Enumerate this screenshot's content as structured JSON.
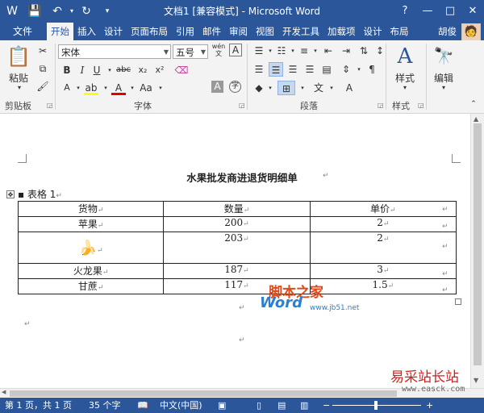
{
  "window": {
    "title": "文档1 [兼容模式] - Microsoft Word",
    "controls": [
      "?",
      "—",
      "□",
      "✕"
    ]
  },
  "quick_access": [
    "save-icon",
    "undo-icon",
    "redo-icon",
    "customize-icon"
  ],
  "tabs": {
    "file": "文件",
    "items": [
      "开始",
      "插入",
      "设计",
      "页面布局",
      "引用",
      "邮件",
      "审阅",
      "视图",
      "开发工具",
      "加载项",
      "设计",
      "布局"
    ],
    "active": 0,
    "user": "胡俊"
  },
  "ribbon": {
    "clipboard": {
      "paste": "粘贴",
      "label": "剪贴板"
    },
    "font": {
      "name": "宋体",
      "size": "五号",
      "label": "字体",
      "buttons": [
        "B",
        "I",
        "U",
        "abc",
        "x₂",
        "x²"
      ],
      "wen": "wén",
      "aa": "Aa"
    },
    "paragraph": {
      "label": "段落"
    },
    "styles": {
      "button": "样式",
      "label": "样式"
    },
    "editing": {
      "button": "编辑"
    }
  },
  "document": {
    "title": "水果批发商进退货明细单",
    "caption": "表格  1",
    "table": {
      "headers": [
        "货物",
        "数量",
        "单价"
      ],
      "rows": [
        [
          "苹果",
          "200",
          "2"
        ],
        [
          "🍌",
          "203",
          "2"
        ],
        [
          "火龙果",
          "187",
          "3"
        ],
        [
          "甘蔗",
          "117",
          "1.5"
        ]
      ]
    }
  },
  "watermark": {
    "text1": "脚本之家",
    "text2": "Word",
    "text3": "www.jb51.net",
    "text4": "易采站长站",
    "text5": "www.easck.com"
  },
  "status": {
    "page": "第 1 页，共 1 页",
    "words": "35 个字",
    "language": "中文(中国)"
  },
  "colors": {
    "accent": "#2b579a",
    "ribbon_bg": "#f3f3f3"
  }
}
